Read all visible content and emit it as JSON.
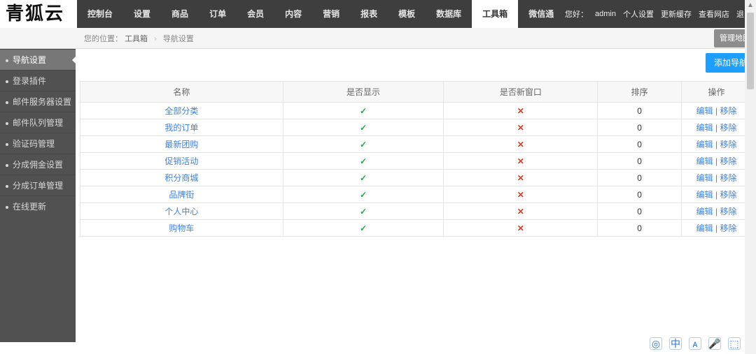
{
  "brand": "青狐云",
  "nav": [
    {
      "label": "控制台"
    },
    {
      "label": "设置"
    },
    {
      "label": "商品"
    },
    {
      "label": "订单"
    },
    {
      "label": "会员"
    },
    {
      "label": "内容"
    },
    {
      "label": "营销"
    },
    {
      "label": "报表"
    },
    {
      "label": "模板"
    },
    {
      "label": "数据库"
    },
    {
      "label": "工具箱",
      "active": true
    },
    {
      "label": "微信通"
    }
  ],
  "topright": {
    "greeting": "您好：",
    "user": "admin",
    "links": [
      "个人设置",
      "更新缓存",
      "查看网店",
      "退出"
    ]
  },
  "breadcrumb": {
    "prefix": "您的位置：",
    "p1": "工具箱",
    "p2": "导航设置",
    "btn": "管理地图"
  },
  "sidebar": [
    {
      "label": "导航设置",
      "active": true
    },
    {
      "label": "登录插件"
    },
    {
      "label": "邮件服务器设置"
    },
    {
      "label": "邮件队列管理"
    },
    {
      "label": "验证码管理"
    },
    {
      "label": "分成佣金设置"
    },
    {
      "label": "分成订单管理"
    },
    {
      "label": "在线更新"
    }
  ],
  "btn_add": "添加导航",
  "table": {
    "headers": [
      "名称",
      "是否显示",
      "是否新窗口",
      "排序",
      "操作"
    ],
    "rows": [
      {
        "name": "全部分类",
        "show": true,
        "newwin": false,
        "sort": "0"
      },
      {
        "name": "我的订单",
        "show": true,
        "newwin": false,
        "sort": "0"
      },
      {
        "name": "最新团购",
        "show": true,
        "newwin": false,
        "sort": "0"
      },
      {
        "name": "促销活动",
        "show": true,
        "newwin": false,
        "sort": "0"
      },
      {
        "name": "积分商城",
        "show": true,
        "newwin": false,
        "sort": "0"
      },
      {
        "name": "品牌街",
        "show": true,
        "newwin": false,
        "sort": "0"
      },
      {
        "name": "个人中心",
        "show": true,
        "newwin": false,
        "sort": "0"
      },
      {
        "name": "购物车",
        "show": true,
        "newwin": false,
        "sort": "0"
      }
    ],
    "op_edit": "编辑",
    "op_sep": " | ",
    "op_remove": "移除"
  },
  "mark_check": "✓",
  "mark_cross": "✕",
  "tray": [
    "◎",
    "中",
    "ᴀ",
    "🎤",
    "⬚"
  ]
}
